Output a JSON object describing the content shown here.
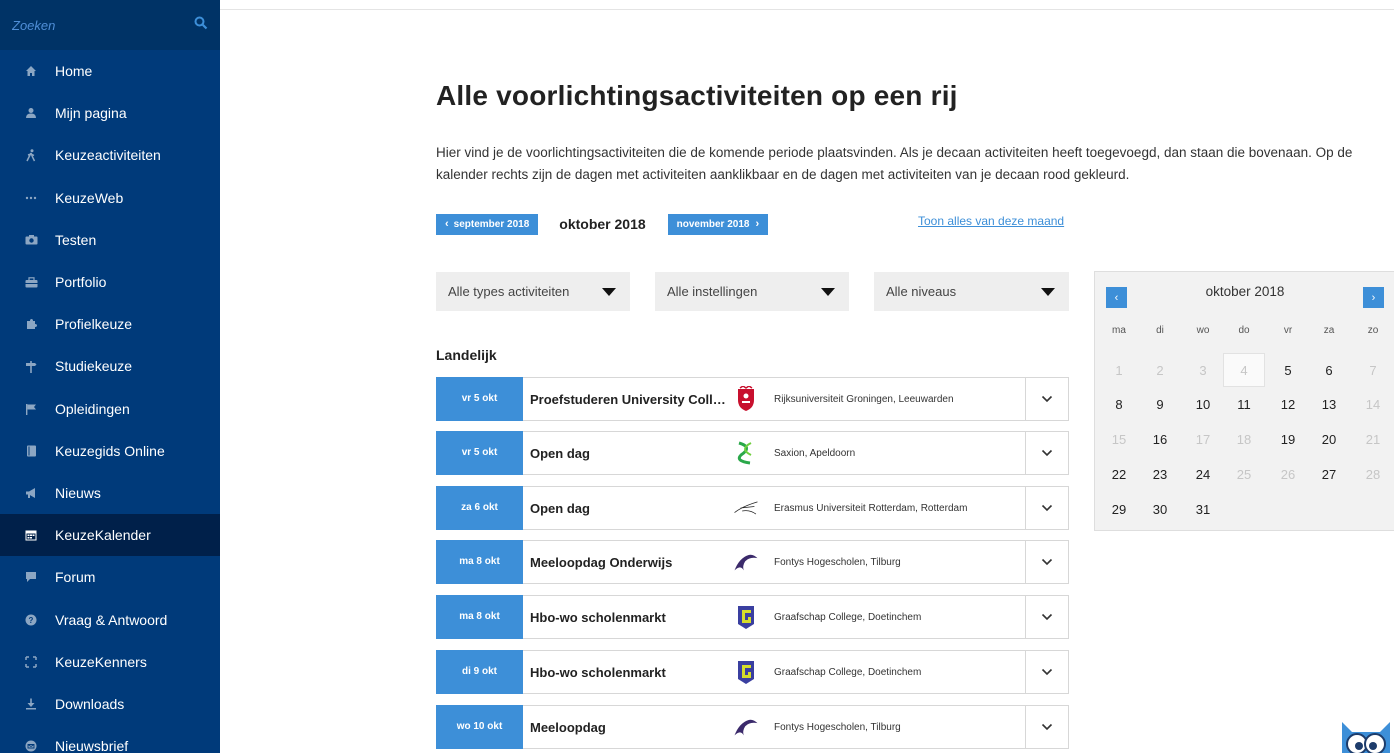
{
  "search": {
    "placeholder": "Zoeken"
  },
  "sidebar": {
    "items": [
      {
        "label": "Home",
        "icon": "home-icon"
      },
      {
        "label": "Mijn pagina",
        "icon": "user-icon"
      },
      {
        "label": "Keuzeactiviteiten",
        "icon": "walker-icon"
      },
      {
        "label": "KeuzeWeb",
        "icon": "dots-icon"
      },
      {
        "label": "Testen",
        "icon": "camera-icon"
      },
      {
        "label": "Portfolio",
        "icon": "briefcase-icon"
      },
      {
        "label": "Profielkeuze",
        "icon": "puzzle-icon"
      },
      {
        "label": "Studiekeuze",
        "icon": "signpost-icon"
      },
      {
        "label": "Opleidingen",
        "icon": "flag-icon"
      },
      {
        "label": "Keuzegids Online",
        "icon": "book-icon"
      },
      {
        "label": "Nieuws",
        "icon": "megaphone-icon"
      },
      {
        "label": "KeuzeKalender",
        "icon": "calendar-icon",
        "active": true
      },
      {
        "label": "Forum",
        "icon": "chat-icon"
      },
      {
        "label": "Vraag & Antwoord",
        "icon": "question-icon"
      },
      {
        "label": "KeuzeKenners",
        "icon": "expand-icon"
      },
      {
        "label": "Downloads",
        "icon": "download-icon"
      },
      {
        "label": "Nieuwsbrief",
        "icon": "mail-icon"
      }
    ]
  },
  "main": {
    "title": "Alle voorlichtingsactiviteiten op een rij",
    "intro": "Hier vind je de voorlichtingsactiviteiten die de komende periode plaatsvinden. Als je decaan activiteiten heeft toegevoegd, dan staan die bovenaan. Op de kalender rechts zijn de dagen met activiteiten aanklikbaar en de dagen met activiteiten van je decaan rood gekleurd.",
    "prev_month": "september 2018",
    "current_month": "oktober 2018",
    "next_month": "november 2018",
    "show_all": "Toon alles van deze maand",
    "filters": [
      "Alle types activiteiten",
      "Alle instellingen",
      "Alle niveaus"
    ],
    "section": "Landelijk",
    "events": [
      {
        "date": "vr 5 okt",
        "name": "Proefstuderen University College ...",
        "institution": "Rijksuniversiteit Groningen, Leeuwarden",
        "logo": "rug-logo"
      },
      {
        "date": "vr 5 okt",
        "name": "Open dag",
        "institution": "Saxion, Apeldoorn",
        "logo": "saxion-logo"
      },
      {
        "date": "za 6 okt",
        "name": "Open dag",
        "institution": "Erasmus Universiteit Rotterdam, Rotterdam",
        "logo": "erasmus-logo"
      },
      {
        "date": "ma 8 okt",
        "name": "Meeloopdag Onderwijs",
        "institution": "Fontys Hogescholen, Tilburg",
        "logo": "fontys-logo"
      },
      {
        "date": "ma 8 okt",
        "name": "Hbo-wo scholenmarkt",
        "institution": "Graafschap College, Doetinchem",
        "logo": "graafschap-logo"
      },
      {
        "date": "di 9 okt",
        "name": "Hbo-wo scholenmarkt",
        "institution": "Graafschap College, Doetinchem",
        "logo": "graafschap-logo"
      },
      {
        "date": "wo 10 okt",
        "name": "Meeloopdag",
        "institution": "Fontys Hogescholen, Tilburg",
        "logo": "fontys-logo"
      }
    ]
  },
  "calendar": {
    "title": "oktober 2018",
    "prev": "‹",
    "next": "›",
    "weekdays": [
      "ma",
      "di",
      "wo",
      "do",
      "vr",
      "za",
      "zo"
    ],
    "weeks": [
      [
        {
          "d": "1",
          "active": false
        },
        {
          "d": "2",
          "active": false
        },
        {
          "d": "3",
          "active": false
        },
        {
          "d": "4",
          "active": false,
          "today": true
        },
        {
          "d": "5",
          "active": true
        },
        {
          "d": "6",
          "active": true
        },
        {
          "d": "7",
          "active": false
        }
      ],
      [
        {
          "d": "8",
          "active": true
        },
        {
          "d": "9",
          "active": true
        },
        {
          "d": "10",
          "active": true
        },
        {
          "d": "11",
          "active": true
        },
        {
          "d": "12",
          "active": true
        },
        {
          "d": "13",
          "active": true
        },
        {
          "d": "14",
          "active": false
        }
      ],
      [
        {
          "d": "15",
          "active": false
        },
        {
          "d": "16",
          "active": true
        },
        {
          "d": "17",
          "active": false
        },
        {
          "d": "18",
          "active": false
        },
        {
          "d": "19",
          "active": true
        },
        {
          "d": "20",
          "active": true
        },
        {
          "d": "21",
          "active": false
        }
      ],
      [
        {
          "d": "22",
          "active": true
        },
        {
          "d": "23",
          "active": true
        },
        {
          "d": "24",
          "active": true
        },
        {
          "d": "25",
          "active": false
        },
        {
          "d": "26",
          "active": false
        },
        {
          "d": "27",
          "active": true
        },
        {
          "d": "28",
          "active": false
        }
      ],
      [
        {
          "d": "29",
          "active": true
        },
        {
          "d": "30",
          "active": true
        },
        {
          "d": "31",
          "active": true
        }
      ]
    ]
  },
  "colors": {
    "sidebar": "#003a7a",
    "sidebar_active": "#00204a",
    "accent": "#3d8fd8"
  }
}
